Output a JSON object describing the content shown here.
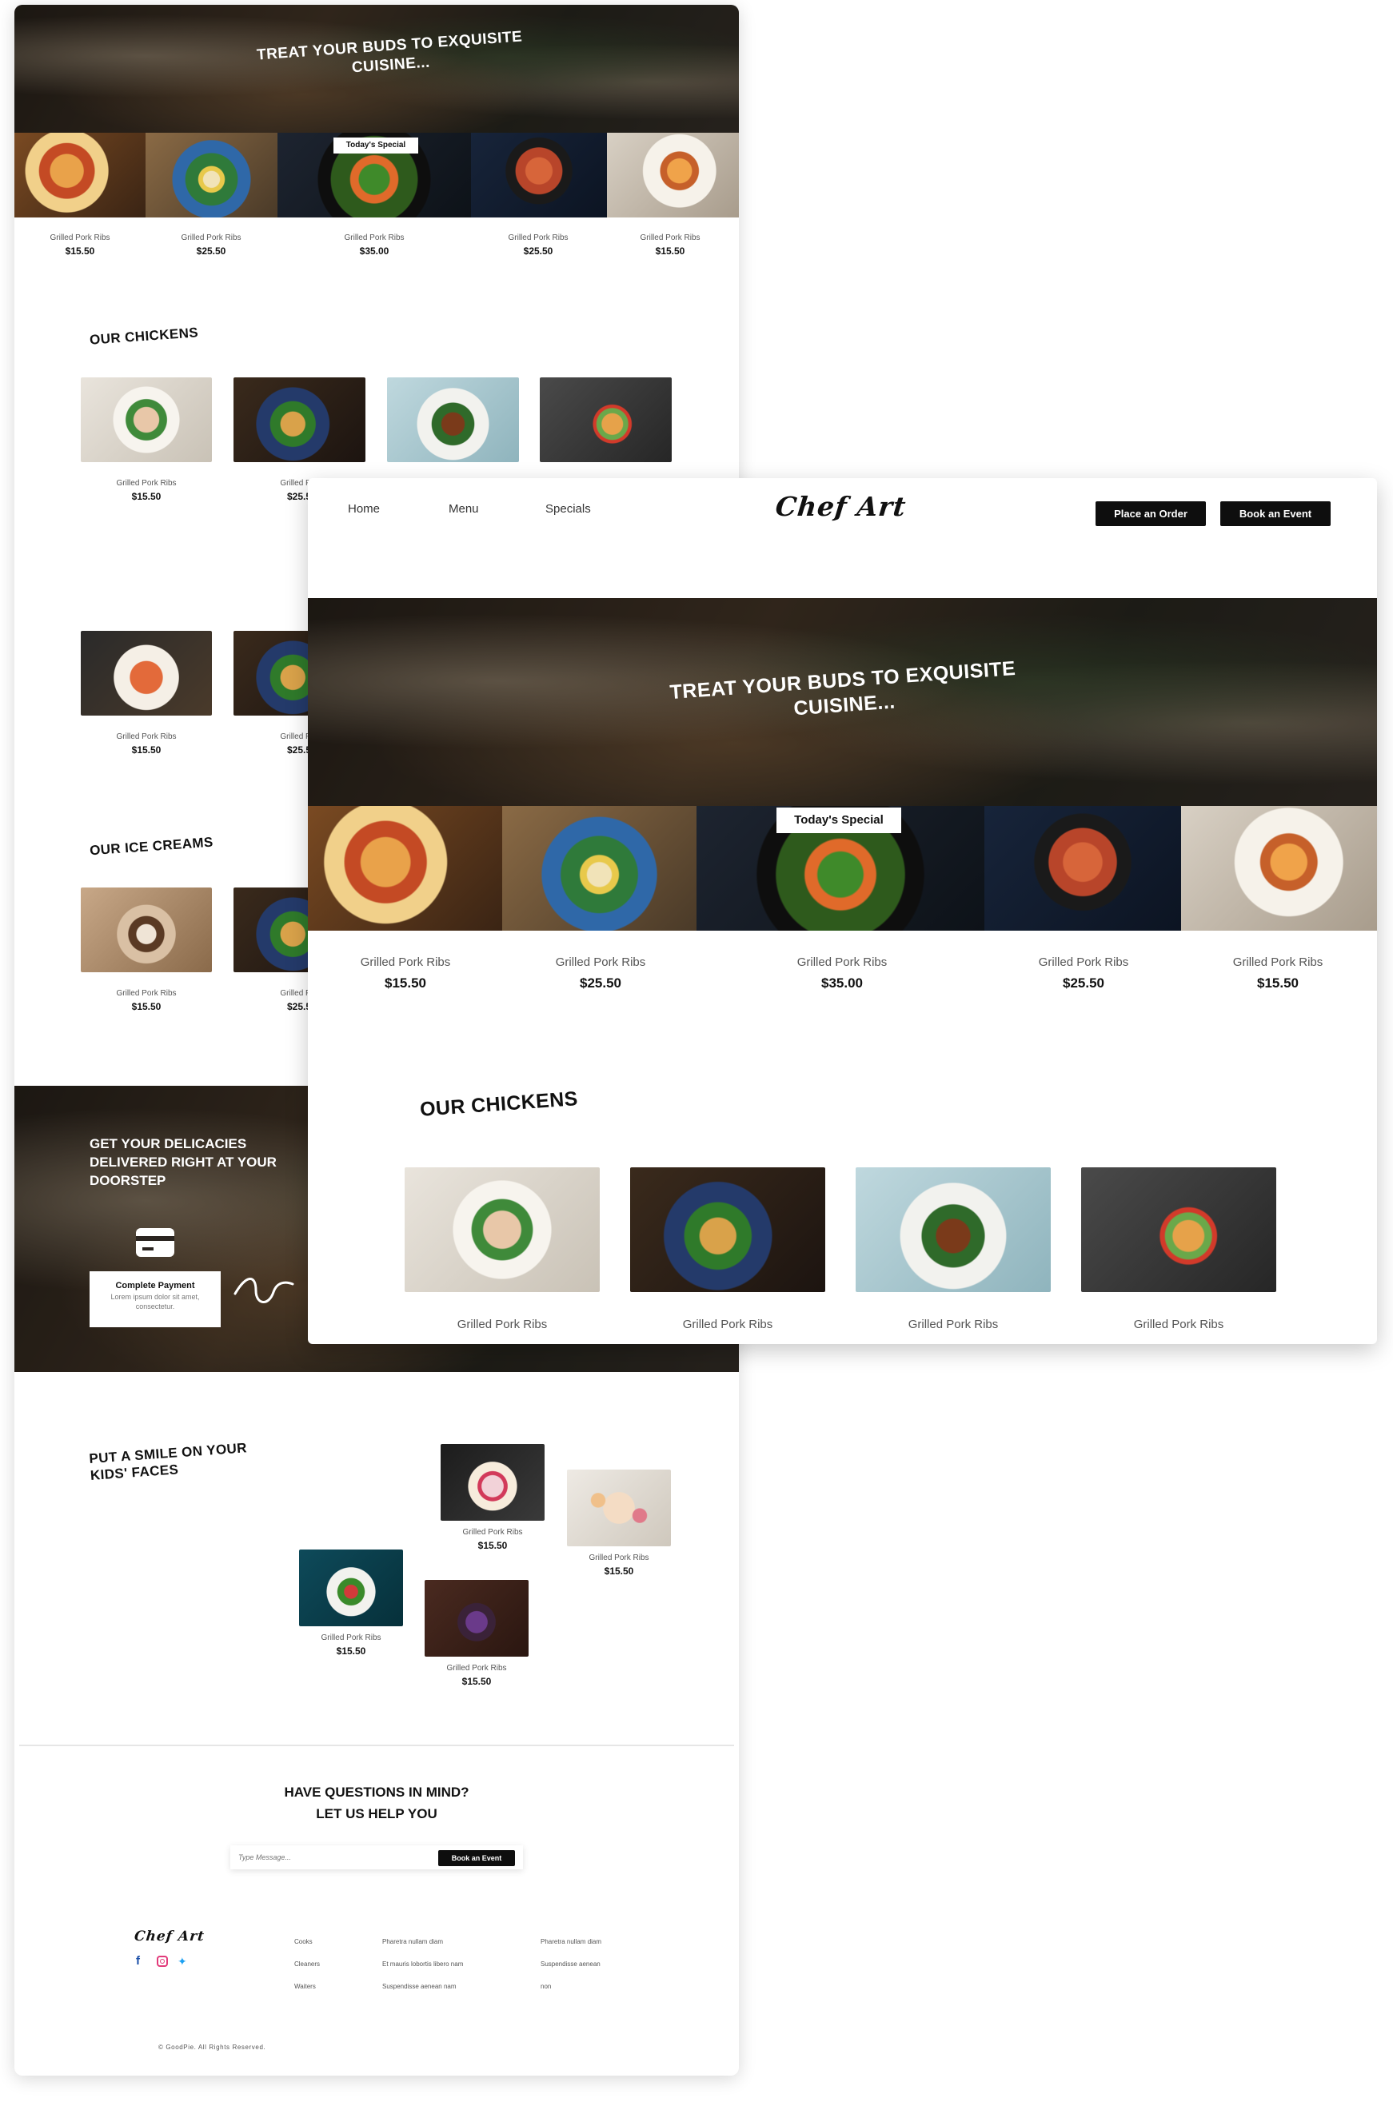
{
  "brand": {
    "logo_text": "Chef Art",
    "accent": "#0e0e0e",
    "background": "#ffffff"
  },
  "nav": {
    "home": "Home",
    "menu": "Menu",
    "specials": "Specials",
    "place_order": "Place an Order",
    "book_event": "Book an Event"
  },
  "hero": {
    "title": "Treat your buds to exquisite cuisine..."
  },
  "specials": {
    "badge": "Today's Special",
    "items": [
      {
        "name": "Grilled Pork Ribs",
        "price": "$15.50"
      },
      {
        "name": "Grilled Pork Ribs",
        "price": "$25.50"
      },
      {
        "name": "Grilled Pork Ribs",
        "price": "$35.00"
      },
      {
        "name": "Grilled Pork Ribs",
        "price": "$25.50"
      },
      {
        "name": "Grilled Pork Ribs",
        "price": "$15.50"
      }
    ]
  },
  "chickens": {
    "title": "Our Chickens",
    "items": [
      {
        "name": "Grilled Pork Ribs",
        "price": "$15.50"
      },
      {
        "name": "Grilled Pork Ribs",
        "price": "$25.5"
      },
      {
        "name": "Grilled Pork Ribs",
        "price": ""
      },
      {
        "name": "Grilled Pork Ribs",
        "price": ""
      }
    ]
  },
  "chickens_row2": {
    "items": [
      {
        "name": "Grilled Pork Ribs",
        "price": "$15.50"
      },
      {
        "name": "Grilled Por",
        "price": "$25.5"
      }
    ]
  },
  "ice_creams": {
    "title": "Our Ice Creams",
    "items": [
      {
        "name": "Grilled Pork Ribs",
        "price": "$15.50"
      },
      {
        "name": "Grilled Por",
        "price": "$25.5"
      }
    ]
  },
  "front_chickens_partial_first": "Grilled Por",
  "delivery": {
    "title": "Get your delicacies delivered right at your doorstep",
    "step_title": "Complete Payment",
    "step_text": "Lorem ipsum dolor sit amet, consectetur."
  },
  "kids": {
    "title": "Put a smile on your kids' faces",
    "items": [
      {
        "name": "Grilled Pork Ribs",
        "price": "$15.50"
      },
      {
        "name": "Grilled Pork Ribs",
        "price": "$15.50"
      },
      {
        "name": "Grilled Pork Ribs",
        "price": "$15.50"
      },
      {
        "name": "Grilled Pork Ribs",
        "price": "$15.50"
      }
    ]
  },
  "contact": {
    "title_line1": "Have questions in mind?",
    "title_line2": "Let us help you",
    "placeholder": "Type Message...",
    "button": "Book an Event"
  },
  "footer": {
    "col1": [
      "Cooks",
      "Cleaners",
      "Waiters"
    ],
    "col2": [
      "Pharetra nullam diam",
      "Et mauris lobortis libero nam",
      "Suspendisse aenean nam"
    ],
    "col3": [
      "Pharetra nullam diam",
      "Suspendisse aenean",
      "non"
    ],
    "copyright": "© GoodPie. All Rights Reserved.",
    "social": [
      "facebook-icon",
      "instagram-icon",
      "twitter-icon"
    ]
  }
}
